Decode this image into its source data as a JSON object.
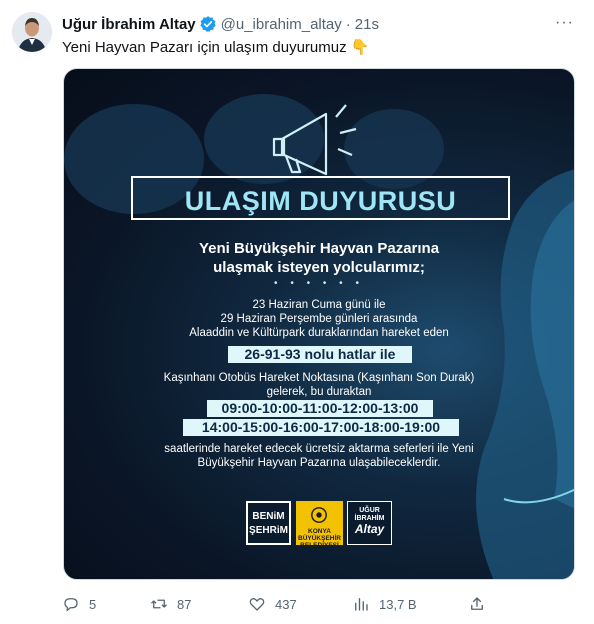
{
  "tweet": {
    "author": {
      "display_name": "Uğur İbrahim Altay",
      "handle": "@u_ibrahim_altay",
      "verified": true
    },
    "time_separator": "·",
    "timestamp": "21s",
    "more_label": "···",
    "text": "Yeni Hayvan Pazarı için ulaşım duyurumuz 👇"
  },
  "poster": {
    "title": "ULAŞIM DUYURUSU",
    "heading_line1": "Yeni Büyükşehir Hayvan Pazarına",
    "heading_line2": "ulaşmak isteyen yolcularımız;",
    "dots": "• • • • • •",
    "date_line1": "23 Haziran Cuma günü ile",
    "date_line2": "29 Haziran Perşembe günleri arasında",
    "date_line3": "Alaaddin ve Kültürpark duraklarından hareket eden",
    "lines_highlight": "26-91-93 nolu hatlar ile",
    "stop_line1": "Kaşınhanı Otobüs Hareket Noktasına (Kaşınhanı Son Durak)",
    "stop_line2": "gelerek, bu duraktan",
    "times_row1": "09:00-10:00-11:00-12:00-13:00",
    "times_row2": "14:00-15:00-16:00-17:00-18:00-19:00",
    "footer_line1": "saatlerinde hareket edecek ücretsiz aktarma seferleri ile Yeni",
    "footer_line2": "Büyükşehir Hayvan Pazarına ulaşabileceklerdir.",
    "logo1_line1": "BENiM",
    "logo1_line2": "ŞEHRiM",
    "logo2_line1": "KONYA",
    "logo2_line2": "BÜYÜKŞEHİR",
    "logo2_line3": "BELEDİYESİ",
    "logo3_line1": "UĞUR",
    "logo3_line2": "İBRAHİM",
    "logo3_line3": "Altay"
  },
  "actions": {
    "replies": "5",
    "retweets": "87",
    "likes": "437",
    "views": "13,7 B"
  },
  "colors": {
    "verified": "#1d9bf0",
    "muted": "#536471",
    "poster_highlight": "#dff7fb",
    "poster_title": "#9ee6f5"
  },
  "icons": [
    "avatar",
    "verified-badge-icon",
    "more-icon",
    "megaphone-icon",
    "reply-icon",
    "retweet-icon",
    "like-icon",
    "views-icon",
    "share-icon"
  ]
}
